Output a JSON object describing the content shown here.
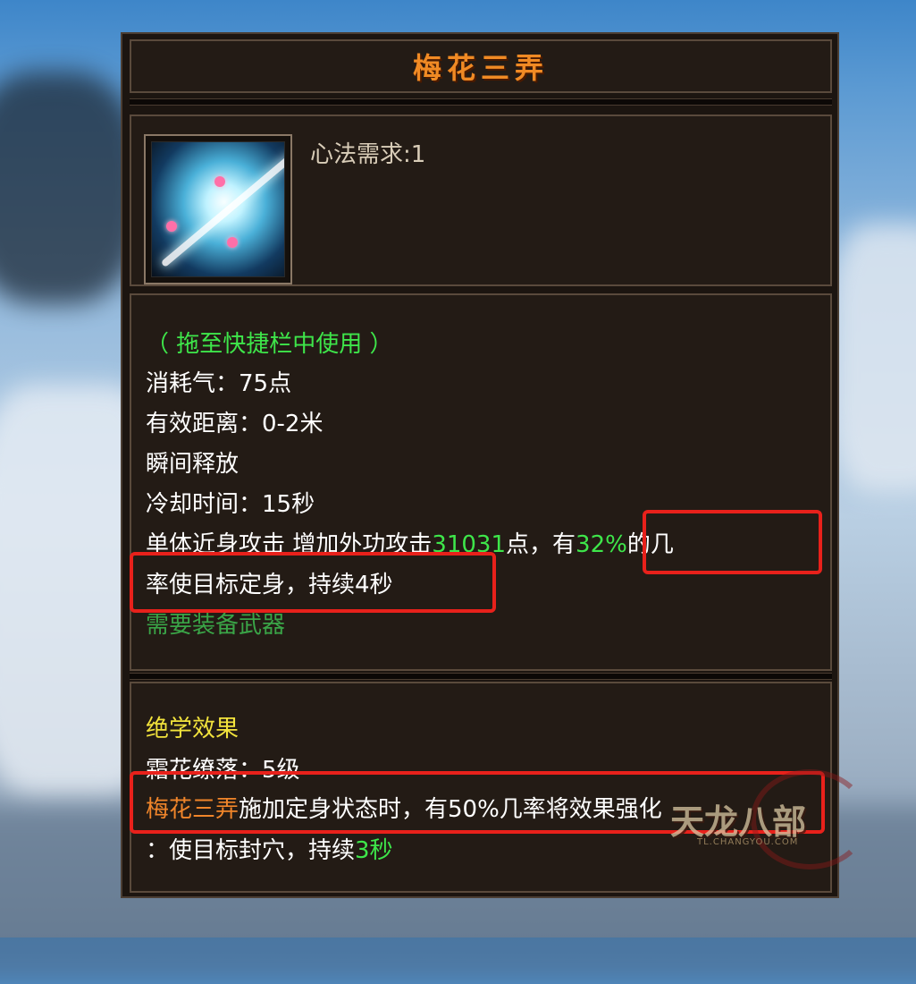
{
  "tooltip": {
    "title": "梅花三弄",
    "header": {
      "requirement": "心法需求:1"
    },
    "description": {
      "usage_hint": "（ 拖至快捷栏中使用 ）",
      "cost": "消耗气：75点",
      "range": "有效距离：0-2米",
      "cast": "瞬间释放",
      "cooldown": "冷却时间：15秒",
      "effect_a": "单体近身攻击",
      "effect_b": "增加外功攻击",
      "effect_value": "31031",
      "effect_c": "点",
      "effect_d": "，有",
      "effect_pct": "32%",
      "effect_e": "的几",
      "effect_line2": "率使目标定身，持续4秒",
      "requirement": "需要装备武器"
    },
    "skill": {
      "header": "绝学效果",
      "level_line": "霜花缭落：5级",
      "line1_skill": "梅花三弄",
      "line1_rest": "施加定身状态时，有50%几率将效果强化",
      "line2_main": "：使目标封穴，持续",
      "line2_value": "3秒"
    }
  },
  "watermark": {
    "logo": "天龙八部",
    "url": "TL.CHANGYOU.COM"
  },
  "colors": {
    "title": "#f08a24",
    "hint_green": "#3ee64a",
    "value_green": "#3ee64a",
    "header_yellow": "#f2e33c",
    "highlight_red": "#e8211b"
  }
}
